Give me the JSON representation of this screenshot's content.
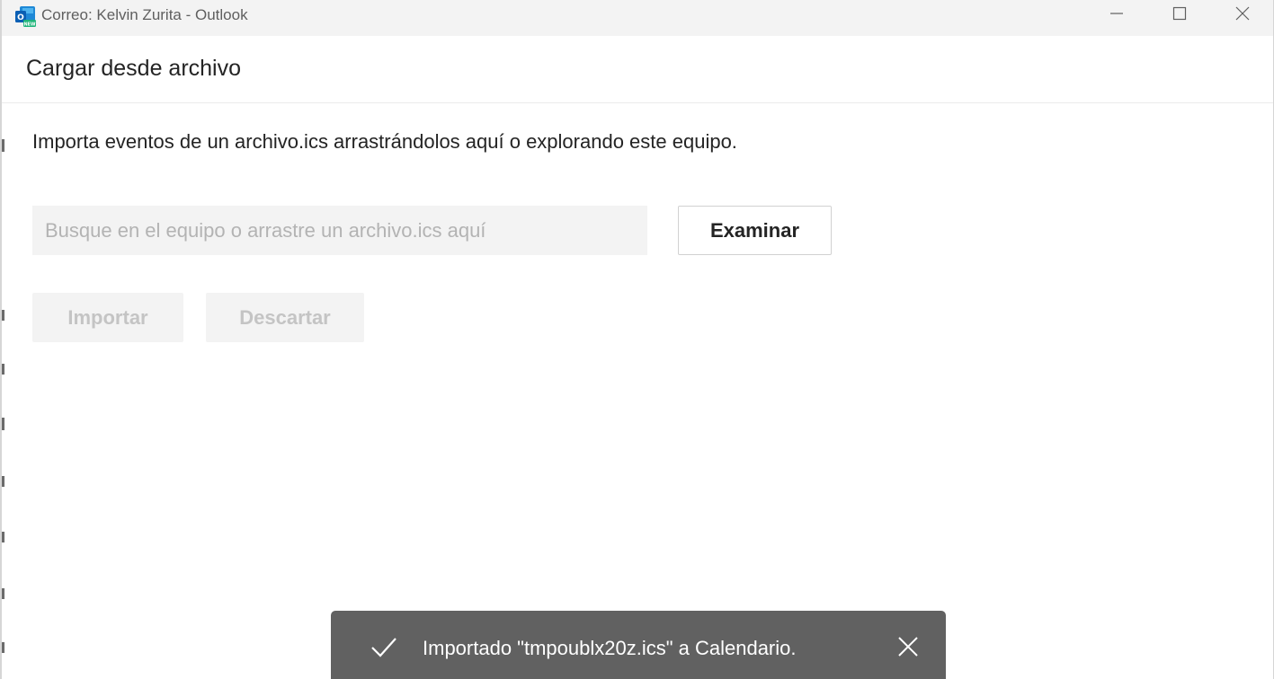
{
  "window": {
    "title": "Correo: Kelvin Zurita - Outlook",
    "app_icon": "outlook-new-icon",
    "controls": [
      "minimize-icon",
      "maximize-icon",
      "close-icon"
    ]
  },
  "dialog": {
    "title": "Cargar desde archivo",
    "instructions": "Importa eventos de un archivo.ics arrastrándolos aquí o explorando este equipo.",
    "file_input": {
      "value": "",
      "placeholder": "Busque en el equipo o arrastre un archivo.ics aquí"
    },
    "browse_label": "Examinar",
    "import_label": "Importar",
    "discard_label": "Descartar"
  },
  "toast": {
    "icon": "checkmark-icon",
    "message": "Importado \"tmpoublx20z.ics\" a Calendario.",
    "close_icon": "close-icon"
  },
  "colors": {
    "titlebar_bg": "#f3f3f3",
    "toast_bg": "#616161",
    "disabled_text": "#c4c4c4",
    "input_bg": "#f3f3f3"
  }
}
